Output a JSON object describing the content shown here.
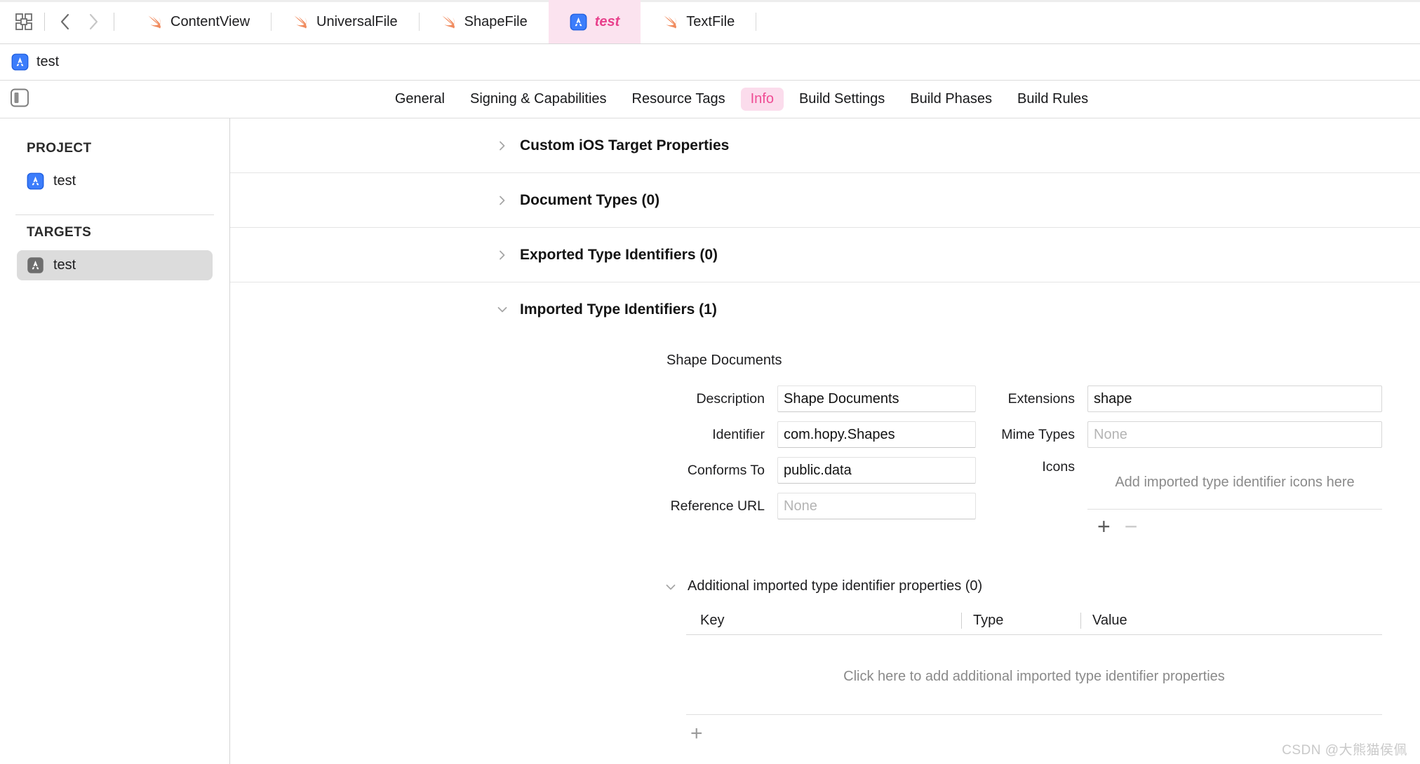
{
  "toolbar": {
    "grid_icon": "grid-icon",
    "back_icon": "chevron-left-icon",
    "forward_icon": "chevron-right-icon",
    "tabs": [
      {
        "label": "ContentView",
        "icon": "swift-icon",
        "active": false
      },
      {
        "label": "UniversalFile",
        "icon": "swift-icon",
        "active": false
      },
      {
        "label": "ShapeFile",
        "icon": "swift-icon",
        "active": false
      },
      {
        "label": "test",
        "icon": "app-icon",
        "active": true
      },
      {
        "label": "TextFile",
        "icon": "swift-icon",
        "active": false
      }
    ]
  },
  "breadcrumb": {
    "icon": "app-icon",
    "label": "test"
  },
  "editor_tabs": {
    "sidebar_toggle_icon": "sidebar-toggle-icon",
    "items": [
      {
        "label": "General",
        "active": false
      },
      {
        "label": "Signing & Capabilities",
        "active": false
      },
      {
        "label": "Resource Tags",
        "active": false
      },
      {
        "label": "Info",
        "active": true
      },
      {
        "label": "Build Settings",
        "active": false
      },
      {
        "label": "Build Phases",
        "active": false
      },
      {
        "label": "Build Rules",
        "active": false
      }
    ]
  },
  "sidebar": {
    "project_header": "PROJECT",
    "project_items": [
      {
        "label": "test",
        "icon": "app-icon-blue",
        "selected": false
      }
    ],
    "targets_header": "TARGETS",
    "target_items": [
      {
        "label": "test",
        "icon": "app-icon-gray",
        "selected": true
      }
    ]
  },
  "main": {
    "sections": [
      {
        "title": "Custom iOS Target Properties",
        "expanded": false,
        "triangle": "chevron-right-icon"
      },
      {
        "title": "Document Types (0)",
        "expanded": false,
        "triangle": "chevron-right-icon"
      },
      {
        "title": "Exported Type Identifiers (0)",
        "expanded": false,
        "triangle": "chevron-right-icon"
      },
      {
        "title": "Imported Type Identifiers (1)",
        "expanded": true,
        "triangle": "chevron-down-icon"
      }
    ],
    "imported_type": {
      "group_title": "Shape Documents",
      "left_fields": [
        {
          "label": "Description",
          "value": "Shape Documents",
          "placeholder": ""
        },
        {
          "label": "Identifier",
          "value": "com.hopy.Shapes",
          "placeholder": ""
        },
        {
          "label": "Conforms To",
          "value": "public.data",
          "placeholder": ""
        },
        {
          "label": "Reference URL",
          "value": "",
          "placeholder": "None"
        }
      ],
      "right_fields": [
        {
          "label": "Extensions",
          "value": "shape",
          "placeholder": ""
        },
        {
          "label": "Mime Types",
          "value": "",
          "placeholder": "None"
        }
      ],
      "icons_label": "Icons",
      "icons_hint": "Add imported type identifier icons here",
      "add_button": "+",
      "remove_button": "−"
    },
    "additional": {
      "triangle": "chevron-down-icon",
      "title": "Additional imported type identifier properties (0)",
      "columns": [
        "Key",
        "Type",
        "Value"
      ],
      "empty_text": "Click here to add additional imported type identifier properties",
      "add_button": "+"
    }
  },
  "watermark": "CSDN @大熊猫侯佩",
  "colors": {
    "accent_pink": "#ef4c94",
    "tab_active_bg": "#fbe3ef",
    "info_pill_bg": "#fbdcec",
    "swift_orange": "#f08a5d",
    "app_icon_blue": "#3c7dfb",
    "selected_gray": "#dcdcdc"
  }
}
